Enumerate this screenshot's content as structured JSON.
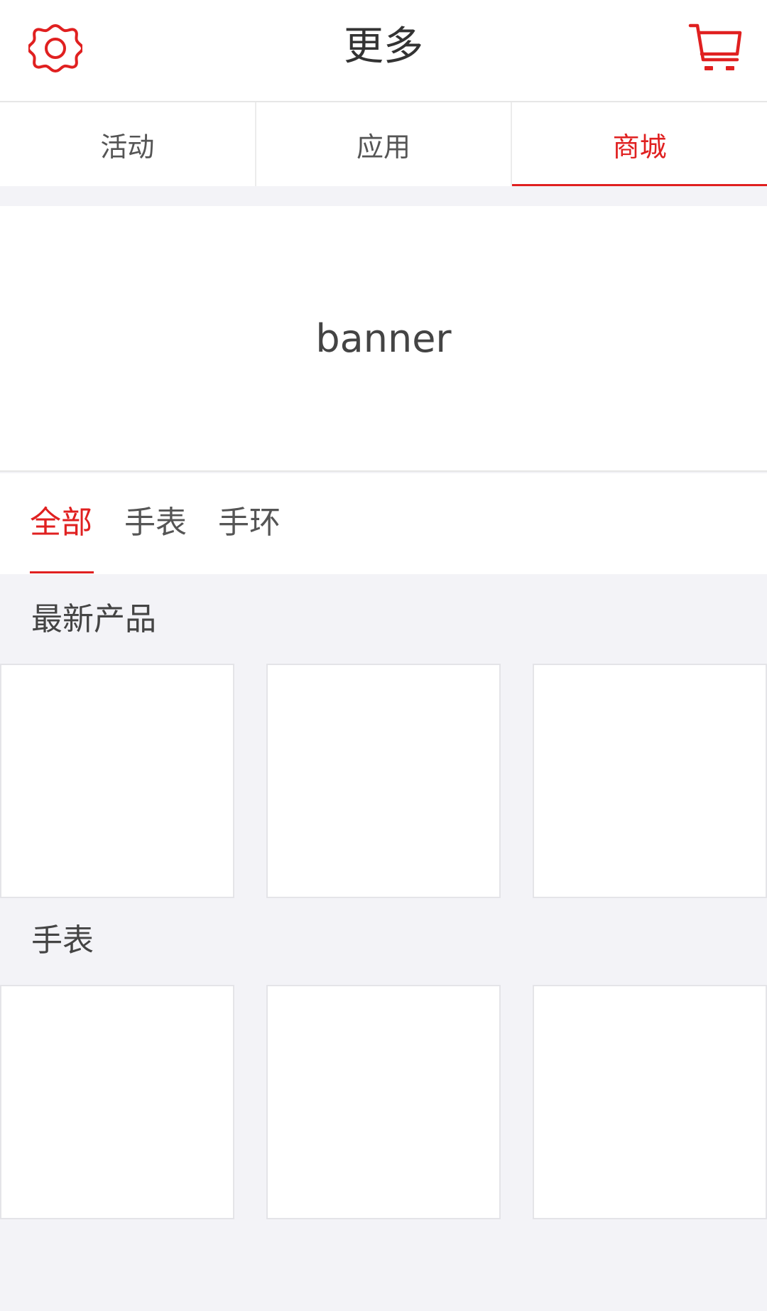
{
  "header": {
    "title": "更多",
    "settings_icon": "gear-icon",
    "cart_icon": "shopping-cart-icon"
  },
  "top_tabs": [
    {
      "label": "活动",
      "active": false
    },
    {
      "label": "应用",
      "active": false
    },
    {
      "label": "商城",
      "active": true
    }
  ],
  "banner": {
    "label": "banner"
  },
  "category_tabs": [
    {
      "label": "全部",
      "active": true
    },
    {
      "label": "手表",
      "active": false
    },
    {
      "label": "手环",
      "active": false
    }
  ],
  "sections": [
    {
      "title": "最新产品"
    },
    {
      "title": "手表"
    }
  ],
  "colors": {
    "accent": "#e02020",
    "background": "#f3f3f7",
    "text": "#333333"
  }
}
